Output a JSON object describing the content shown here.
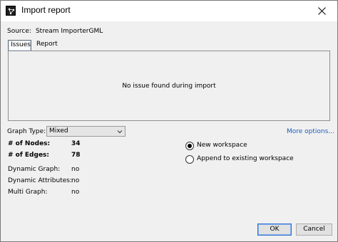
{
  "window": {
    "title": "Import report",
    "app_icon": "gephi-icon",
    "close_icon": "close-icon"
  },
  "source": {
    "label": "Source:",
    "value": "Stream ImporterGML"
  },
  "tabs": [
    {
      "label": "Issues",
      "selected": true
    },
    {
      "label": "Report",
      "selected": false
    }
  ],
  "issues": {
    "message": "No issue found during import"
  },
  "graph_type": {
    "label": "Graph Type:",
    "selected": "Mixed",
    "dropdown_icon": "chevron-down-icon"
  },
  "more_options": "More options...",
  "stats": {
    "nodes_label": "# of Nodes:",
    "nodes_value": "34",
    "edges_label": "# of Edges:",
    "edges_value": "78",
    "dynamic_graph_label": "Dynamic Graph:",
    "dynamic_graph_value": "no",
    "dynamic_attributes_label": "Dynamic Attributes:",
    "dynamic_attributes_value": "no",
    "multi_graph_label": "Multi Graph:",
    "multi_graph_value": "no"
  },
  "workspace_options": [
    {
      "label": "New workspace",
      "selected": true
    },
    {
      "label": "Append to existing workspace",
      "selected": false
    }
  ],
  "buttons": {
    "ok": "OK",
    "cancel": "Cancel"
  },
  "colors": {
    "link": "#1d5db8",
    "dialog_bg": "#f0f0f0",
    "default_button_border": "#2f6fd0"
  }
}
